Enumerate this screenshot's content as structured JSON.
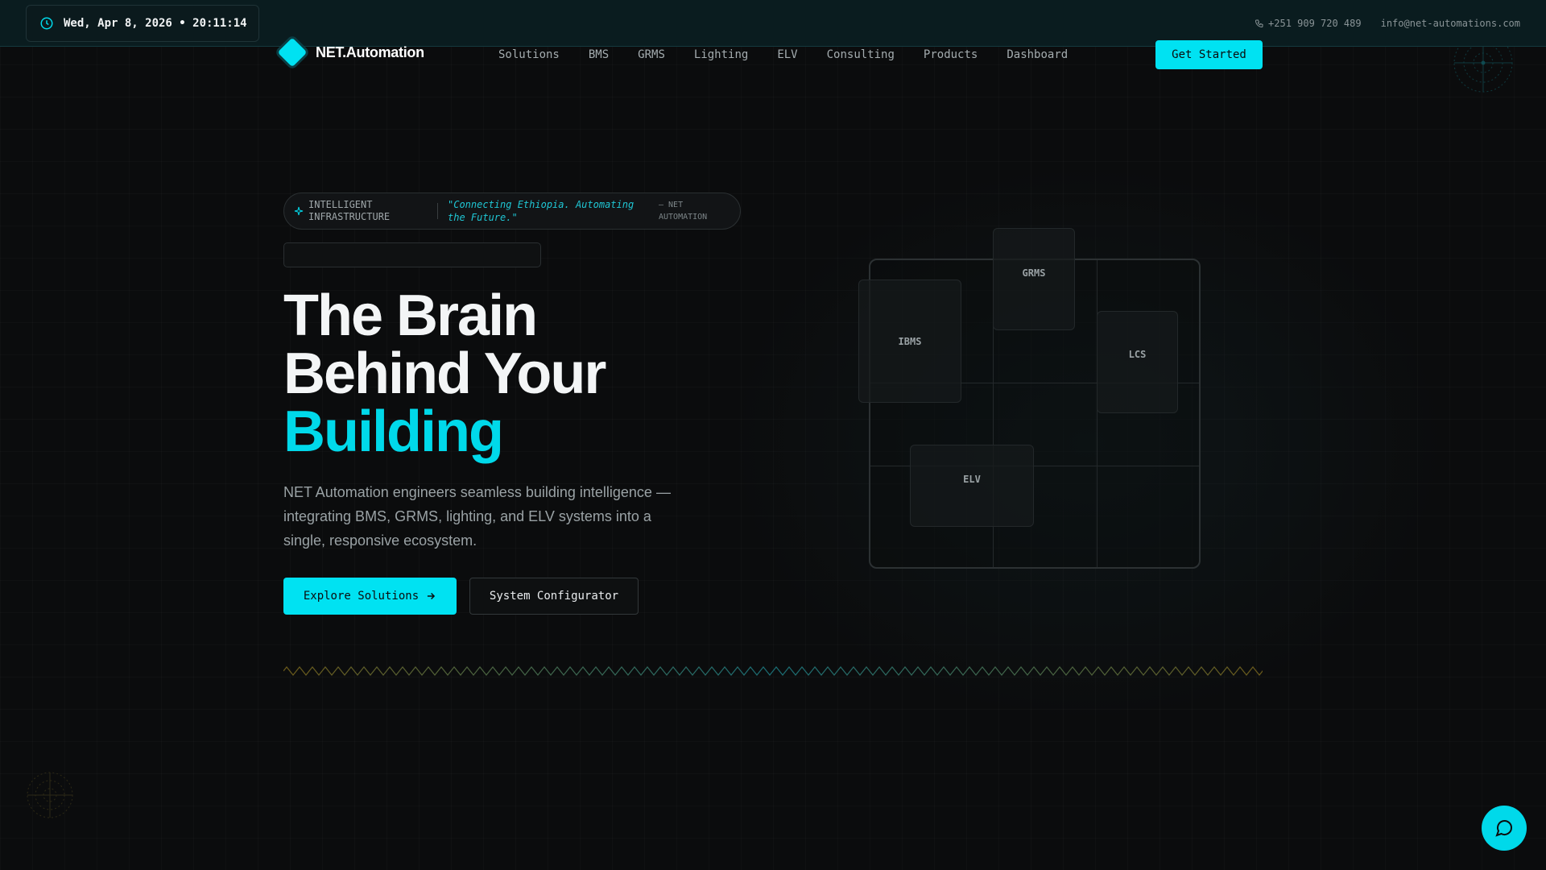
{
  "topbar": {
    "datetime": "Wed, Apr 8, 2026 • 20:11:14",
    "phone": "+251 909 720 489",
    "email": "info@net-automations.com"
  },
  "nav": {
    "logo_text": "NET.Automation",
    "links": [
      "Solutions",
      "BMS",
      "GRMS",
      "Lighting",
      "ELV",
      "Consulting",
      "Products",
      "Dashboard"
    ],
    "cta": "Get Started"
  },
  "hero": {
    "tag_label": "INTELLIGENT INFRASTRUCTURE",
    "tag_quote": "\"Connecting Ethiopia. Automating the Future.\"",
    "tag_attribution": "— NET AUTOMATION",
    "headline_line1": "The Brain",
    "headline_line2": "Behind Your",
    "headline_accent": "Building",
    "subtext": "NET Automation engineers seamless building intelligence — integrating BMS, GRMS, lighting, and ELV systems into a single, responsive ecosystem.",
    "primary_button": "Explore Solutions",
    "secondary_button": "System Configurator"
  },
  "diagram": {
    "modules": [
      "GRMS",
      "IBMS",
      "LCS",
      "ELV"
    ]
  },
  "colors": {
    "accent": "#00e2f2",
    "background": "#0b0c0d",
    "topbar": "#0a1c1f"
  },
  "icons": {
    "clock": "clock-icon",
    "phone": "phone-icon",
    "tag": "sparkle-icon",
    "arrow": "arrow-right-icon",
    "chat": "chat-bubble-icon"
  }
}
